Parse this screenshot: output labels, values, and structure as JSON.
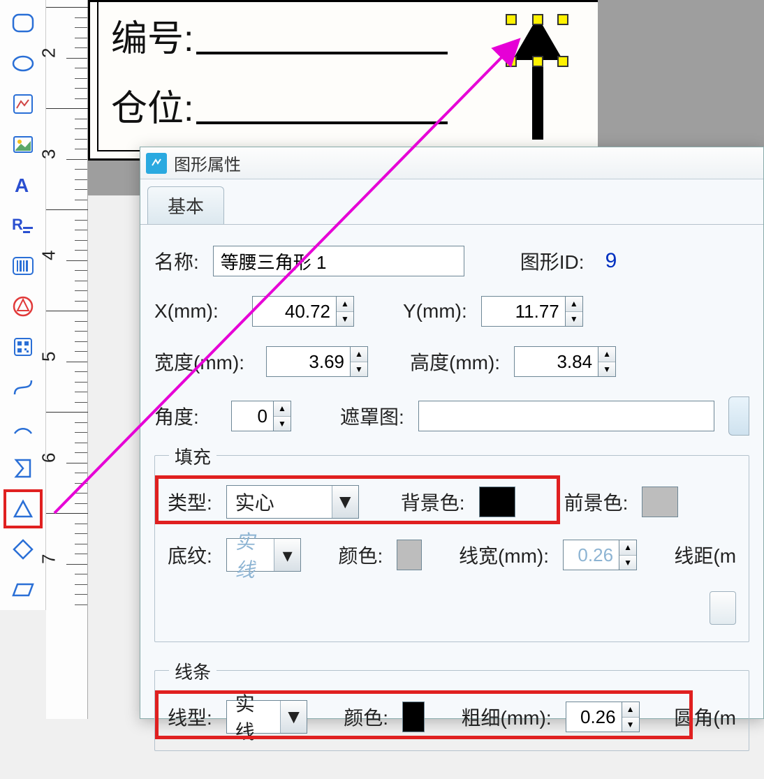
{
  "canvas": {
    "field1_label": "编号:",
    "field2_label": "仓位:"
  },
  "ruler": {
    "ticks": [
      "2",
      "3",
      "4",
      "5",
      "6",
      "7"
    ]
  },
  "dialog": {
    "title": "图形属性",
    "tab_basic": "基本",
    "name_label": "名称:",
    "name_value": "等腰三角形 1",
    "shapeid_label": "图形ID:",
    "shapeid_value": "9",
    "x_label": "X(mm):",
    "x_value": "40.72",
    "y_label": "Y(mm):",
    "y_value": "11.77",
    "width_label": "宽度(mm):",
    "width_value": "3.69",
    "height_label": "高度(mm):",
    "height_value": "3.84",
    "angle_label": "角度:",
    "angle_value": "0",
    "mask_label": "遮罩图:",
    "fill": {
      "legend": "填充",
      "type_label": "类型:",
      "type_value": "实心",
      "bg_label": "背景色:",
      "fg_label": "前景色:",
      "pattern_label": "底纹:",
      "pattern_value": "实线",
      "color_label": "颜色:",
      "linew_label": "线宽(mm):",
      "linew_value": "0.26",
      "linedist_label": "线距(m"
    },
    "line": {
      "legend": "线条",
      "type_label": "线型:",
      "type_value": "实线",
      "color_label": "颜色:",
      "thick_label": "粗细(mm):",
      "thick_value": "0.26",
      "radius_label": "圆角(m"
    }
  }
}
